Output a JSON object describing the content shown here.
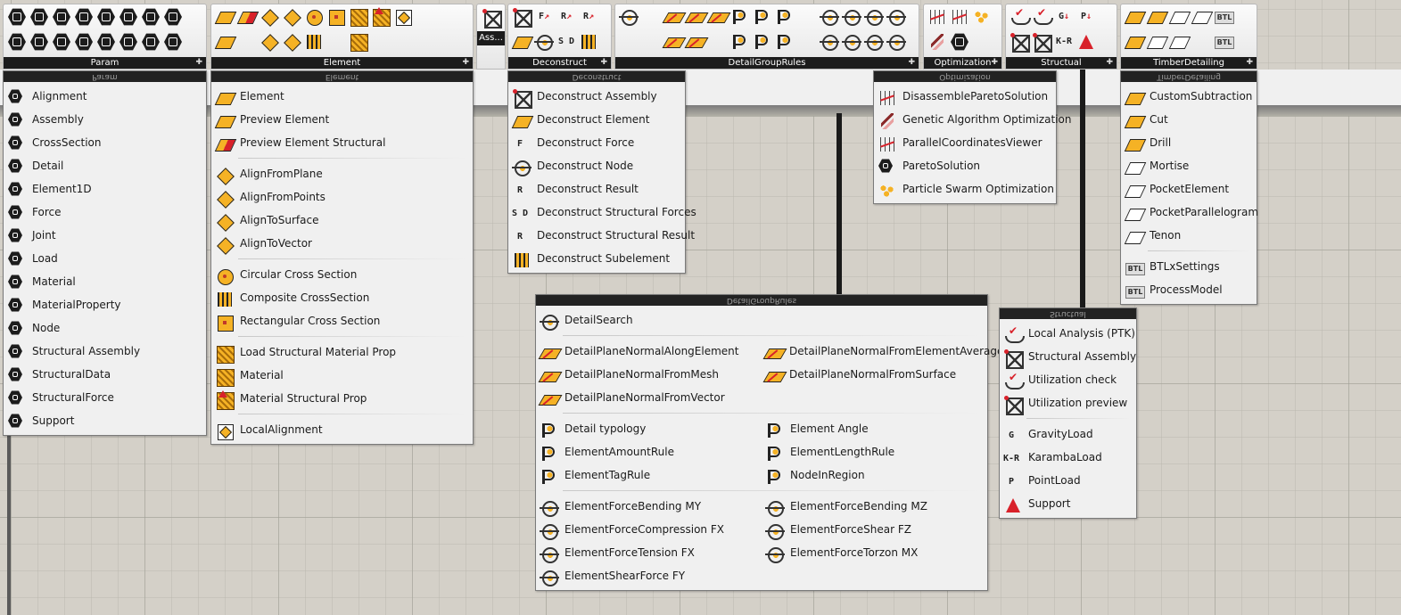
{
  "ribbon": {
    "groups": [
      {
        "id": "param",
        "label": "Param"
      },
      {
        "id": "element",
        "label": "Element"
      },
      {
        "id": "assembly",
        "label": "Ass..."
      },
      {
        "id": "deconstruct",
        "label": "Deconstruct"
      },
      {
        "id": "detailgrouprules",
        "label": "DetailGroupRules"
      },
      {
        "id": "optimization",
        "label": "Optimization"
      },
      {
        "id": "structural",
        "label": "Structual"
      },
      {
        "id": "timberdetailing",
        "label": "TimberDetailing"
      }
    ],
    "expand_glyph": "✚"
  },
  "menus": {
    "param": {
      "title": "Param",
      "items": [
        "Alignment",
        "Assembly",
        "CrossSection",
        "Detail",
        "Element1D",
        "Force",
        "Joint",
        "Load",
        "Material",
        "MaterialProperty",
        "Node",
        "Structural Assembly",
        "StructuralData",
        "StructuralForce",
        "Support"
      ]
    },
    "element": {
      "title": "Element",
      "sections": [
        [
          "Element",
          "Preview Element",
          "Preview Element Structural"
        ],
        [
          "AlignFromPlane",
          "AlignFromPoints",
          "AlignToSurface",
          "AlignToVector"
        ],
        [
          "Circular Cross Section",
          "Composite CrossSection",
          "Rectangular Cross Section"
        ],
        [
          "Load Structural Material Prop",
          "Material",
          "Material Structural Prop"
        ],
        [
          "LocalAlignment"
        ]
      ]
    },
    "deconstruct": {
      "title": "Deconstruct",
      "items": [
        "Deconstruct Assembly",
        "Deconstruct Element",
        "Deconstruct Force",
        "Deconstruct Node",
        "Deconstruct Result",
        "Deconstruct Structural Forces",
        "Deconstruct Structural Result",
        "Deconstruct Subelement"
      ]
    },
    "optimization": {
      "title": "Optimization",
      "items": [
        "DisassembleParetoSolution",
        "Genetic Algorithm Optimization",
        "ParallelCoordinatesViewer",
        "ParetoSolution",
        "Particle Swarm Optimization"
      ]
    },
    "timberdetailing": {
      "title": "TimberDetailing",
      "sections": [
        [
          "CustomSubtraction",
          "Cut",
          "Drill",
          "Mortise",
          "PocketElement",
          "PocketParallelogram",
          "Tenon"
        ],
        [
          "BTLxSettings",
          "ProcessModel"
        ]
      ]
    },
    "detailgrouprules": {
      "title": "DetailGroupRules",
      "sections": [
        {
          "left": [
            "DetailSearch"
          ],
          "right": []
        },
        {
          "left": [
            "DetailPlaneNormalAlongElement",
            "DetailPlaneNormalFromMesh",
            "DetailPlaneNormalFromVector"
          ],
          "right": [
            "DetailPlaneNormalFromElementAverage",
            "DetailPlaneNormalFromSurface"
          ]
        },
        {
          "left": [
            "Detail typology",
            "ElementAmountRule",
            "ElementTagRule"
          ],
          "right": [
            "Element Angle",
            "ElementLengthRule",
            "NodeInRegion"
          ]
        },
        {
          "left": [
            "ElementForceBending MY",
            "ElementForceCompression FX",
            "ElementForceTension FX",
            "ElementShearForce FY"
          ],
          "right": [
            "ElementForceBending MZ",
            "ElementForceShear FZ",
            "ElementForceTorzon MX"
          ]
        }
      ]
    },
    "structural": {
      "title": "Structual",
      "sections": [
        [
          "Local Analysis (PTK)",
          "Structural Assembly",
          "Utilization check",
          "Utilization preview"
        ],
        [
          "GravityLoad",
          "KarambaLoad",
          "PointLoad",
          "Support"
        ]
      ]
    }
  },
  "icon_text": {
    "force": "F",
    "result": "R",
    "sd": "S D",
    "gravity": "G",
    "karamba": "K-R",
    "point": "P",
    "btl": "BTL"
  },
  "colors": {
    "accent_yellow": "#f5b225",
    "accent_red": "#d8212a",
    "dark": "#1c1c1c",
    "menu_bg": "#f0f0f0",
    "canvas_bg": "#d4d0c8"
  }
}
